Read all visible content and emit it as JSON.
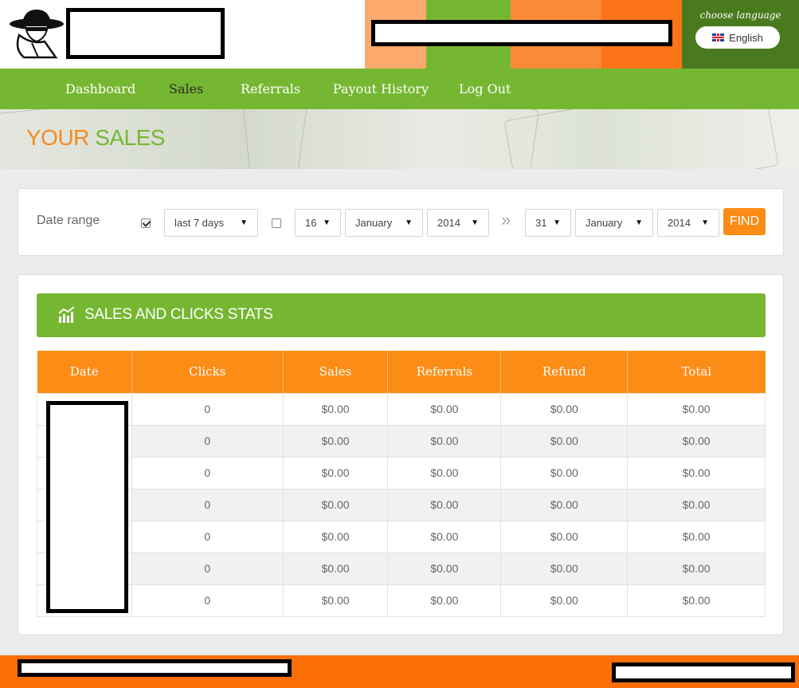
{
  "header": {
    "language_prompt": "choose language",
    "language_label": "English"
  },
  "nav": {
    "items": [
      {
        "label": "Dashboard",
        "active": false
      },
      {
        "label": "Sales",
        "active": true
      },
      {
        "label": "Referrals",
        "active": false
      },
      {
        "label": "Payout History",
        "active": false
      },
      {
        "label": "Log Out",
        "active": false
      }
    ]
  },
  "banner": {
    "title_part1": "YOUR",
    "title_part2": "SALES"
  },
  "filter": {
    "label": "Date range",
    "preset_checked": true,
    "preset_value": "last 7 days",
    "custom_checked": false,
    "from": {
      "day": "16",
      "month": "January",
      "year": "2014"
    },
    "separator": "»",
    "to": {
      "day": "31",
      "month": "January",
      "year": "2014"
    },
    "find_label": "FIND"
  },
  "stats": {
    "title": "SALES AND CLICKS STATS",
    "columns": [
      "Date",
      "Clicks",
      "Sales",
      "Referrals",
      "Refund",
      "Total"
    ],
    "rows": [
      {
        "clicks": "0",
        "sales": "$0.00",
        "referrals": "$0.00",
        "refund": "$0.00",
        "total": "$0.00"
      },
      {
        "clicks": "0",
        "sales": "$0.00",
        "referrals": "$0.00",
        "refund": "$0.00",
        "total": "$0.00"
      },
      {
        "clicks": "0",
        "sales": "$0.00",
        "referrals": "$0.00",
        "refund": "$0.00",
        "total": "$0.00"
      },
      {
        "clicks": "0",
        "sales": "$0.00",
        "referrals": "$0.00",
        "refund": "$0.00",
        "total": "$0.00"
      },
      {
        "clicks": "0",
        "sales": "$0.00",
        "referrals": "$0.00",
        "refund": "$0.00",
        "total": "$0.00"
      },
      {
        "clicks": "0",
        "sales": "$0.00",
        "referrals": "$0.00",
        "refund": "$0.00",
        "total": "$0.00"
      },
      {
        "clicks": "0",
        "sales": "$0.00",
        "referrals": "$0.00",
        "refund": "$0.00",
        "total": "$0.00"
      }
    ]
  },
  "colors": {
    "brand_green": "#76b732",
    "brand_orange": "#fb8c15",
    "footer_orange": "#fb6f09",
    "lang_bg": "#4a7a1e"
  },
  "icons": {
    "logo": "spy-logo-icon",
    "stats": "bar-chart-icon",
    "flag": "uk-flag-icon"
  }
}
